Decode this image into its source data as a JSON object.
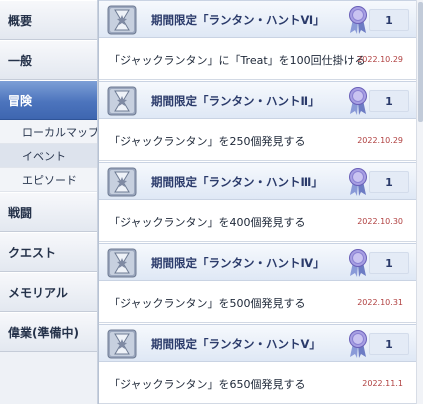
{
  "sidebar": {
    "items": [
      {
        "label": "概要"
      },
      {
        "label": "一般"
      },
      {
        "label": "冒険"
      },
      {
        "label": "ローカルマップ"
      },
      {
        "label": "イベント"
      },
      {
        "label": "エピソード"
      },
      {
        "label": "戦闘"
      },
      {
        "label": "クエスト"
      },
      {
        "label": "メモリアル"
      },
      {
        "label": "偉業(準備中)"
      }
    ]
  },
  "achievements": [
    {
      "title": "期間限定「ランタン・ハントⅥ」",
      "count": "1",
      "description": "「ジャックランタン」に「Treat」を100回仕掛ける",
      "date": "2022.10.29"
    },
    {
      "title": "期間限定「ランタン・ハントⅡ」",
      "count": "1",
      "description": "「ジャックランタン」を250個発見する",
      "date": "2022.10.29"
    },
    {
      "title": "期間限定「ランタン・ハントⅢ」",
      "count": "1",
      "description": "「ジャックランタン」を400個発見する",
      "date": "2022.10.30"
    },
    {
      "title": "期間限定「ランタン・ハントⅣ」",
      "count": "1",
      "description": "「ジャックランタン」を500個発見する",
      "date": "2022.10.31"
    },
    {
      "title": "期間限定「ランタン・ハントⅤ」",
      "count": "1",
      "description": "「ジャックランタン」を650個発見する",
      "date": "2022.11.1"
    }
  ],
  "colors": {
    "active_tab": "#4c74bd",
    "title_text": "#2a3a6a",
    "date_text": "#b04040",
    "medal": "#8f86d8"
  },
  "icons": [
    "hourglass-star-icon",
    "medal-icon"
  ]
}
